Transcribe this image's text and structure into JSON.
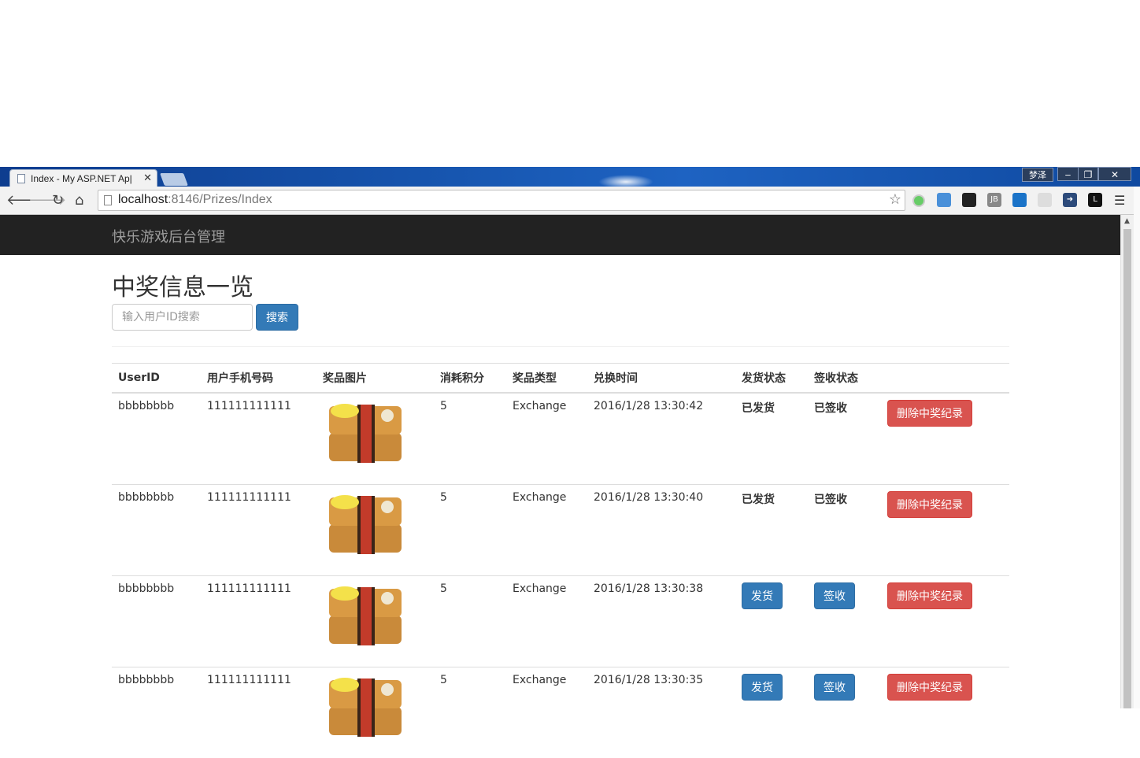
{
  "browser": {
    "tab_title": "Index - My ASP.NET Ap|",
    "tab_close": "✕",
    "window_user": "梦泽",
    "url_host": "localhost",
    "url_path": ":8146/Prizes/Index"
  },
  "nav": {
    "brand": "快乐游戏后台管理"
  },
  "page": {
    "title": "中奖信息一览",
    "search_placeholder": "输入用户ID搜索",
    "search_button": "搜索"
  },
  "table": {
    "headers": [
      "UserID",
      "用户手机号码",
      "奖品图片",
      "消耗积分",
      "奖品类型",
      "兑换时间",
      "发货状态",
      "签收状态",
      ""
    ],
    "rows": [
      {
        "user_id": "bbbbbbbb",
        "phone": "111111111111",
        "points": "5",
        "type": "Exchange",
        "time": "2016/1/28 13:30:42",
        "ship": "已发货",
        "sign": "已签收",
        "delete": "删除中奖纪录"
      },
      {
        "user_id": "bbbbbbbb",
        "phone": "111111111111",
        "points": "5",
        "type": "Exchange",
        "time": "2016/1/28 13:30:40",
        "ship": "已发货",
        "sign": "已签收",
        "delete": "删除中奖纪录"
      },
      {
        "user_id": "bbbbbbbb",
        "phone": "111111111111",
        "points": "5",
        "type": "Exchange",
        "time": "2016/1/28 13:30:38",
        "ship": "发货",
        "sign": "签收",
        "delete": "删除中奖纪录"
      },
      {
        "user_id": "bbbbbbbb",
        "phone": "111111111111",
        "points": "5",
        "type": "Exchange",
        "time": "2016/1/28 13:30:35",
        "ship": "发货",
        "sign": "签收",
        "delete": "删除中奖纪录"
      }
    ]
  },
  "colors": {
    "navbar": "#222222",
    "primary": "#337ab7",
    "danger": "#d9534f"
  }
}
